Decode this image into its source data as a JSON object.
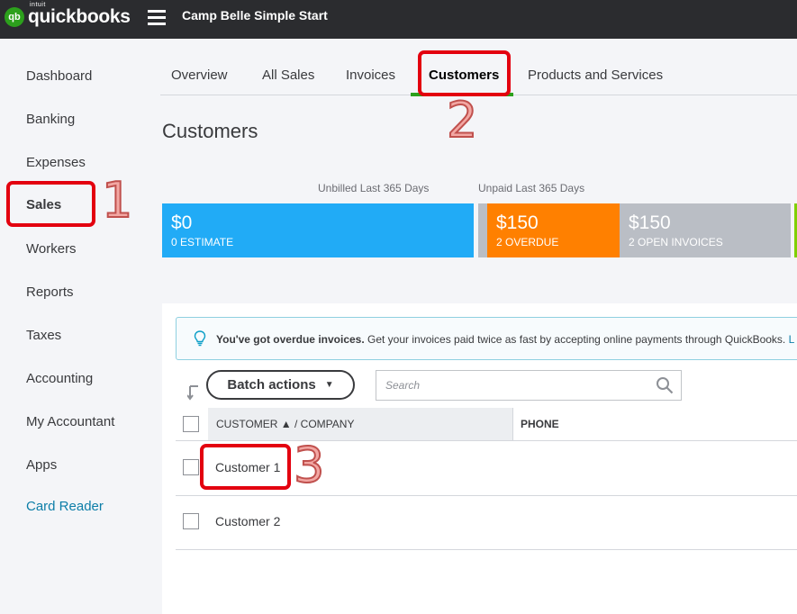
{
  "topbar": {
    "logo_intuit": "intuit",
    "logo_name": "quickbooks",
    "logo_mark": "qb",
    "company_name": "Camp Belle Simple Start"
  },
  "sidebar": {
    "items": [
      {
        "label": "Dashboard"
      },
      {
        "label": "Banking"
      },
      {
        "label": "Expenses"
      },
      {
        "label": "Sales",
        "active": true
      },
      {
        "label": "Workers"
      },
      {
        "label": "Reports"
      },
      {
        "label": "Taxes"
      },
      {
        "label": "Accounting"
      },
      {
        "label": "My Accountant"
      },
      {
        "label": "Apps"
      },
      {
        "label": "Card Reader",
        "link": true
      }
    ]
  },
  "tabs": [
    {
      "label": "Overview"
    },
    {
      "label": "All Sales"
    },
    {
      "label": "Invoices"
    },
    {
      "label": "Customers",
      "active": true
    },
    {
      "label": "Products and Services"
    }
  ],
  "page_title": "Customers",
  "money_bar": {
    "unbilled_label": "Unbilled Last 365 Days",
    "unpaid_label": "Unpaid Last 365 Days",
    "estimate": {
      "amount": "$0",
      "label": "0 ESTIMATE",
      "color": "#21abf6"
    },
    "overdue": {
      "amount": "$150",
      "label": "2 OVERDUE",
      "color": "#ff8000"
    },
    "open_invoices": {
      "amount": "$150",
      "label": "2 OPEN INVOICES",
      "color": "#babec5"
    }
  },
  "banner": {
    "bold_text": "You've got overdue invoices.",
    "text": " Get your invoices paid twice as fast by accepting online payments through QuickBooks. ",
    "link_text": "L"
  },
  "toolbar": {
    "batch_actions_label": "Batch actions",
    "search_placeholder": "Search"
  },
  "table": {
    "col_customer": "CUSTOMER ▲ / COMPANY",
    "col_phone": "PHONE",
    "rows": [
      {
        "name": "Customer 1"
      },
      {
        "name": "Customer 2"
      }
    ]
  },
  "annotations": {
    "step1": "1",
    "step2": "2",
    "step3": "3",
    "callout_color": "#e3000f"
  }
}
